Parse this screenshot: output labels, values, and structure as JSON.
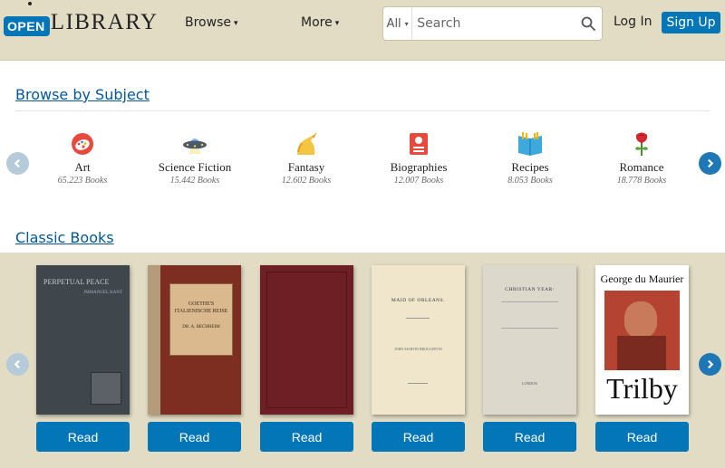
{
  "header": {
    "logo_open": "OPEN",
    "logo_library": "LIBRARY",
    "nav": [
      {
        "label": "Browse"
      },
      {
        "label": "More"
      }
    ],
    "search": {
      "scope": "All",
      "placeholder": "Search"
    },
    "login_label": "Log In",
    "signup_label": "Sign Up"
  },
  "browse_by_subject": {
    "title": "Browse by Subject",
    "subjects": [
      {
        "name": "Art",
        "count": "65.223 Books",
        "icon": "palette-icon"
      },
      {
        "name": "Science Fiction",
        "count": "15.442 Books",
        "icon": "ufo-icon"
      },
      {
        "name": "Fantasy",
        "count": "12.602 Books",
        "icon": "unicorn-icon"
      },
      {
        "name": "Biographies",
        "count": "12.007 Books",
        "icon": "id-badge-icon"
      },
      {
        "name": "Recipes",
        "count": "8.053 Books",
        "icon": "recipe-book-icon"
      },
      {
        "name": "Romance",
        "count": "18.778 Books",
        "icon": "rose-icon"
      }
    ]
  },
  "classic_books": {
    "title": "Classic Books",
    "books": [
      {
        "cover_text": "PERPETUAL PEACE",
        "cover_subtext": "IMMANUEL KANT",
        "read_label": "Read"
      },
      {
        "cover_text": "GOETHE'S ITALIENISCHE REISE",
        "cover_subtext": "DR. A. BECHHEIM",
        "read_label": "Read"
      },
      {
        "cover_text": "",
        "cover_subtext": "",
        "read_label": "Read"
      },
      {
        "cover_text": "MAID OF ORLEANS.",
        "cover_subtext": "JOHN MARTIN BROUGHTON",
        "read_label": "Read"
      },
      {
        "cover_text": "CHRISTIAN YEAR:",
        "cover_subtext": "LONDON",
        "read_label": "Read"
      },
      {
        "cover_text": "George du Maurier",
        "cover_subtext": "Trilby",
        "read_label": "Read"
      }
    ]
  },
  "colors": {
    "brand_blue": "#0376b8",
    "header_bg": "#e2dcc5",
    "link_blue": "#03579a"
  }
}
